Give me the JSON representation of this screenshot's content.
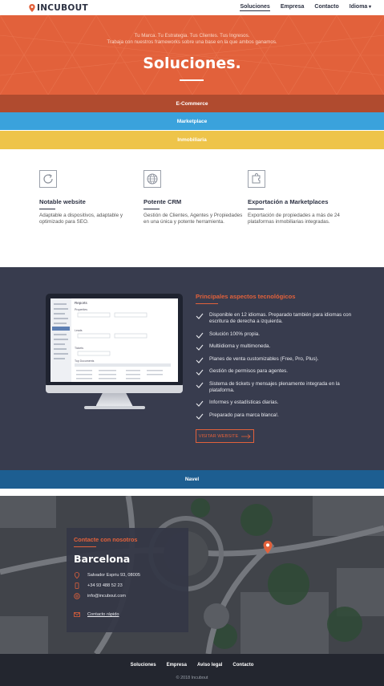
{
  "header": {
    "logo": "INCUBOUT",
    "nav": [
      "Soluciones",
      "Empresa",
      "Contacto",
      "Idioma"
    ]
  },
  "hero": {
    "tagline_1": "Tu Marca. Tu Estrategia. Tus Clientes. Tus Ingresos.",
    "tagline_2": "Trabaja con nuestros frameworks sobre una base en la que ambos ganamos.",
    "title": "Soluciones."
  },
  "bands": {
    "ecommerce": "E-Commerce",
    "marketplace": "Marketplace",
    "inmobiliaria": "Inmobiliaria",
    "navel": "Navel"
  },
  "features": [
    {
      "icon": "refresh-icon",
      "title": "Notable website",
      "text": "Adaptable a dispositivos, adaptable y optimizado para SEO."
    },
    {
      "icon": "globe-icon",
      "title": "Potente CRM",
      "text": "Gestión de Clientes, Agentes y Propiedades en una única y potente herramienta."
    },
    {
      "icon": "puzzle-icon",
      "title": "Exportación a Marketplaces",
      "text": "Exportación de propiedades a más de 24 plataformas inmobiliarias integradas."
    }
  ],
  "tech": {
    "title": "Principales aspectos tecnológicos",
    "items": [
      "Disponible en 12 idiomas. Preparado también para idiomas con escritura de derecha a izquierda.",
      "Solución 100% propia.",
      "Multiidioma y multimoneda.",
      "Planes de venta customizables (Free, Pro, Plus).",
      "Gestión de permisos para agentes.",
      "Sistema de tickets y mensajes plenamente integrada en la plataforma.",
      "Informes y estadísticas diarias.",
      "Preparado para marca blanca!."
    ],
    "button": "VISITAR WEBSITE"
  },
  "monitor": {
    "reports": "Reports",
    "properties": "Properties",
    "leads": "Leads",
    "tickets": "Tickets",
    "documents": "Top Documents"
  },
  "contact": {
    "heading": "Contacte con nosotros",
    "city": "Barcelona",
    "address": "Salvador Espriu 93, 08005",
    "phone": "+34 93 488 52 23",
    "email": "info@incubout.com",
    "quick": "Contacto rápido"
  },
  "footer": {
    "links": [
      "Soluciones",
      "Empresa",
      "Aviso legal",
      "Contacto"
    ],
    "copyright": "© 2018 Incubout"
  },
  "colors": {
    "brand": "#e2613b",
    "dark": "#383c4e",
    "blue": "#3aa2dc",
    "yellow": "#eec44a",
    "navy": "#1d5e91"
  }
}
